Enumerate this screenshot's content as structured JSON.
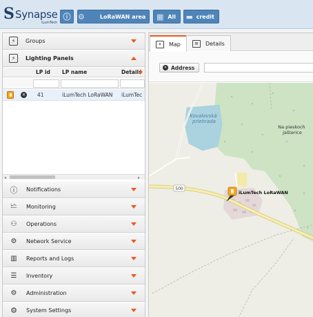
{
  "app": {
    "logo_word": "Synapse",
    "logo_sub": "iLumTech"
  },
  "toolbar": {
    "info_icon": "info-icon",
    "area_label": "LoRaWAN area",
    "calendar_label": "All",
    "credit_label": "credit"
  },
  "sidebar": {
    "sections": [
      {
        "label": "Groups",
        "icon": "groups-icon",
        "expanded": false
      },
      {
        "label": "Lighting Panels",
        "icon": "lighting-icon",
        "expanded": true
      },
      {
        "label": "Notifications",
        "icon": "notification-icon",
        "expanded": false
      },
      {
        "label": "Monitoring",
        "icon": "monitoring-icon",
        "expanded": false
      },
      {
        "label": "Operations",
        "icon": "operations-icon",
        "expanded": false
      },
      {
        "label": "Network Service",
        "icon": "network-icon",
        "expanded": false
      },
      {
        "label": "Reports and Logs",
        "icon": "reports-icon",
        "expanded": false
      },
      {
        "label": "Inventory",
        "icon": "inventory-icon",
        "expanded": false
      },
      {
        "label": "Administration",
        "icon": "admin-icon",
        "expanded": false
      },
      {
        "label": "System Settings",
        "icon": "settings-icon",
        "expanded": false
      }
    ]
  },
  "grid": {
    "columns": [
      "LP id",
      "LP name",
      "Details"
    ],
    "rows": [
      {
        "id": "41",
        "name": "iLumTech LoRaWAN",
        "details": "iLumTec"
      }
    ]
  },
  "tabs": {
    "map": "Map",
    "details": "Details"
  },
  "address": {
    "button_label": "Address",
    "value": ""
  },
  "map": {
    "labels": {
      "lake": "Kovalovská priehrada",
      "place": "Na pieskoch jašterice",
      "road": "500",
      "marker": "iLumTech LoRaWAN"
    }
  },
  "colors": {
    "accent": "#e85a1f",
    "toolbar_button": "#4f84b8",
    "forest": "#cde3c4",
    "water": "#aad3df"
  }
}
